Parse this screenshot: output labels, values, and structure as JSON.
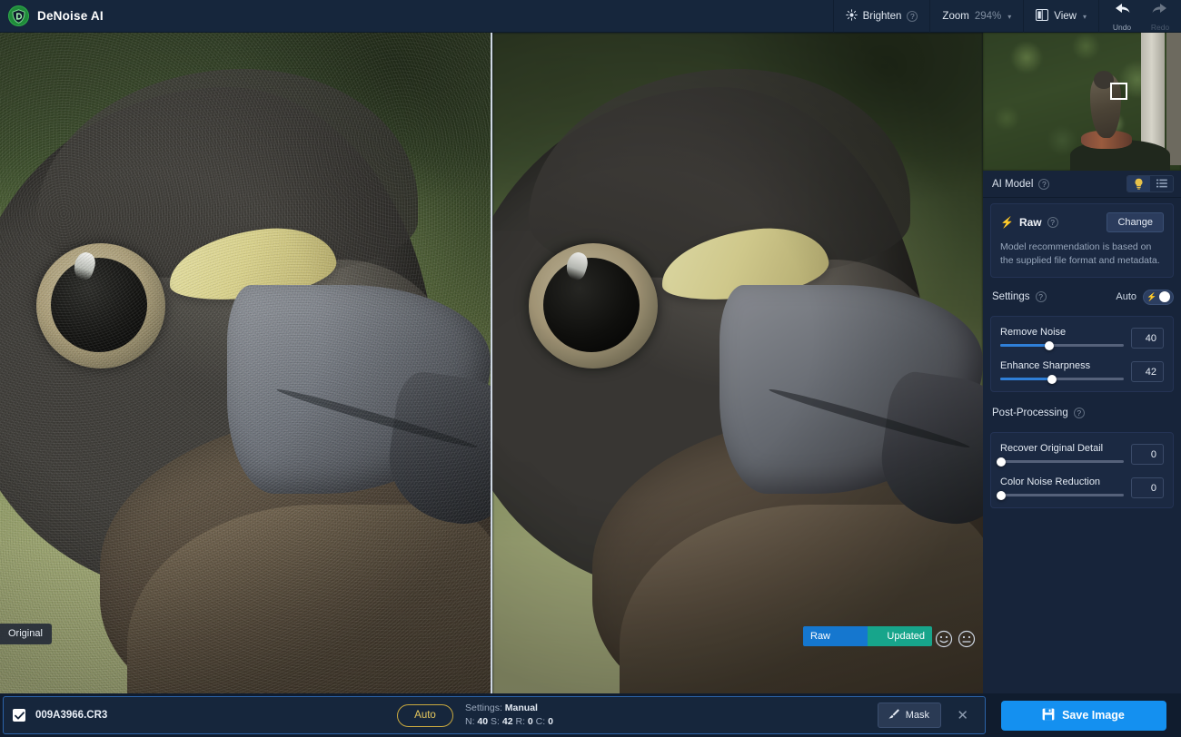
{
  "app": {
    "title": "DeNoise AI",
    "logo_icon": "denoise-shield-logo",
    "accent_blue": "#1490f0",
    "accent_gold": "#e6c85e",
    "panel_bg": "#17243a",
    "topbar_bg": "#16263c"
  },
  "toolbar": {
    "brighten": {
      "label": "Brighten",
      "icon": "sun-brighten-icon",
      "help": "?"
    },
    "zoom": {
      "label": "Zoom",
      "value": "294%",
      "caret": "▾"
    },
    "view": {
      "label": "View",
      "icon": "split-view-icon",
      "caret": "▾"
    },
    "undo": {
      "label": "Undo",
      "icon": "undo-arrow-icon",
      "enabled": true
    },
    "redo": {
      "label": "Redo",
      "icon": "redo-arrow-icon",
      "enabled": false
    }
  },
  "viewer": {
    "original_chip": "Original",
    "compare": {
      "left_label": "Raw",
      "right_label": "Updated",
      "left_color": "#1577cf",
      "right_color": "#17a58b"
    },
    "feedback": {
      "positive_icon": "smiley-face-icon",
      "negative_icon": "frowny-face-icon"
    }
  },
  "navigator": {
    "name": "image-navigator",
    "rect_label": "viewport-rect"
  },
  "panel": {
    "ai_model": {
      "title": "AI Model",
      "help": "?",
      "toggle_icons": {
        "bulb": "lightbulb-icon",
        "list": "list-icon"
      },
      "model_name": "Raw",
      "model_badge_icon": "lightning-bolt-icon",
      "model_help": "?",
      "change_label": "Change",
      "description": "Model recommendation is based on the supplied file format and metadata."
    },
    "settings": {
      "title": "Settings",
      "help": "?",
      "auto_label": "Auto",
      "auto_on": true,
      "sliders": [
        {
          "label": "Remove Noise",
          "value": 40,
          "min": 0,
          "max": 100
        },
        {
          "label": "Enhance Sharpness",
          "value": 42,
          "min": 0,
          "max": 100
        }
      ]
    },
    "post_processing": {
      "title": "Post-Processing",
      "help": "?",
      "sliders": [
        {
          "label": "Recover Original Detail",
          "value": 0,
          "min": 0,
          "max": 100
        },
        {
          "label": "Color Noise Reduction",
          "value": 0,
          "min": 0,
          "max": 100
        }
      ]
    }
  },
  "bottombar": {
    "checkbox_checked": true,
    "filename": "009A3966.CR3",
    "auto_label": "Auto",
    "settings_line1_prefix": "Settings: ",
    "settings_line1_value": "Manual",
    "settings_values": {
      "n_key": "N:",
      "n": "40",
      "s_key": "S:",
      "s": "42",
      "r_key": "R:",
      "r": "0",
      "c_key": "C:",
      "c": "0"
    },
    "mask_label": "Mask",
    "mask_icon": "brush-icon",
    "close_icon": "close-x-icon",
    "save_label": "Save Image",
    "save_icon": "floppy-save-icon"
  }
}
